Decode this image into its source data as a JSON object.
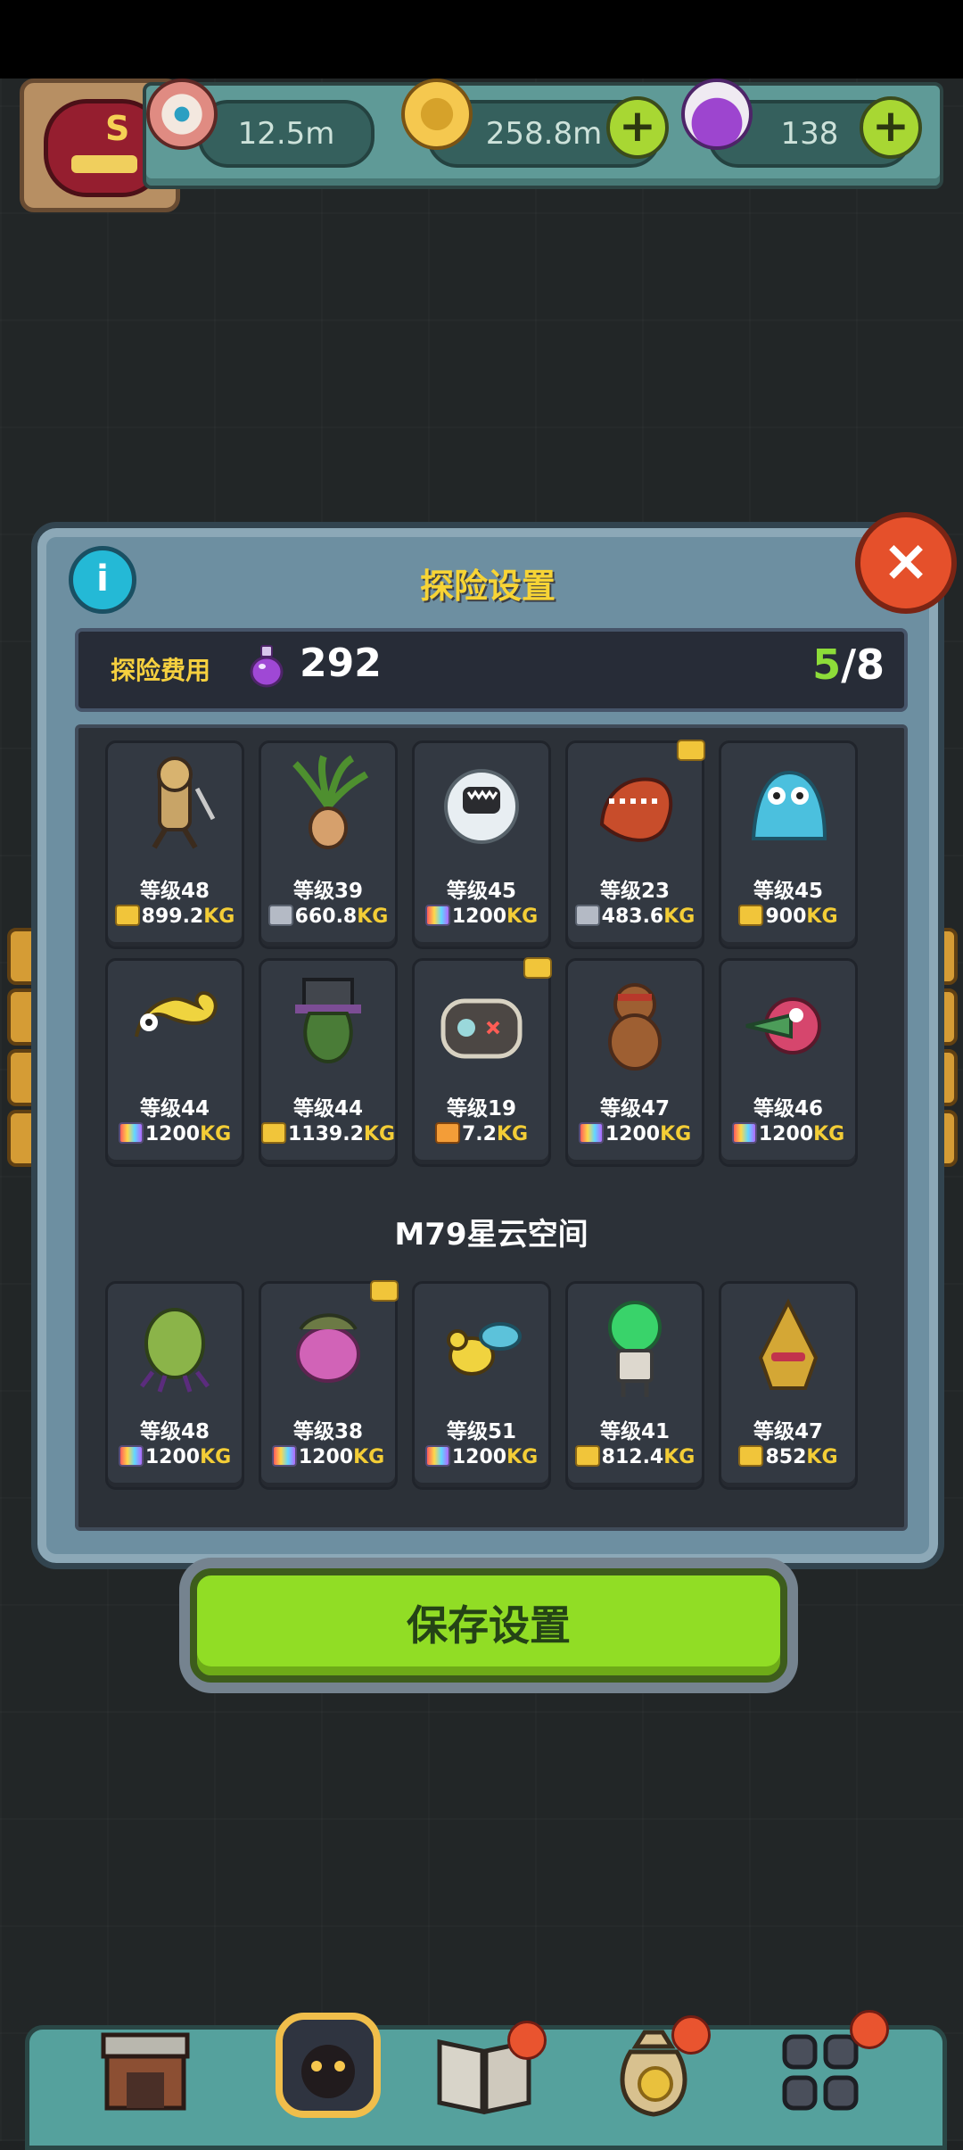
{
  "status_bar": {},
  "resources": {
    "eyes": "12.5m",
    "coins": "258.8m",
    "potions": "138"
  },
  "dialog": {
    "title": "探险设置",
    "cost_label": "探险费用",
    "cost_value": "292",
    "count_current": "5",
    "count_total": "/8",
    "section_label": "M79星云空间",
    "save_label": "保存设置"
  },
  "monsters_top": [
    {
      "level": "等级48",
      "weight": "899.2",
      "unit": "KG",
      "icon": "voodoo-doll",
      "weight_icon": "gold"
    },
    {
      "level": "等级39",
      "weight": "660.8",
      "unit": "KG",
      "icon": "mandrake",
      "weight_icon": "gray"
    },
    {
      "level": "等级45",
      "weight": "1200",
      "unit": "KG",
      "icon": "yeti",
      "weight_icon": "rainbow"
    },
    {
      "level": "等级23",
      "weight": "483.6",
      "unit": "KG",
      "icon": "red-dinosaur",
      "weight_icon": "gray",
      "badge": true
    },
    {
      "level": "等级45",
      "weight": "900",
      "unit": "KG",
      "icon": "blue-slime",
      "weight_icon": "gold"
    },
    {
      "level": "等级44",
      "weight": "1200",
      "unit": "KG",
      "icon": "yellow-lizard",
      "weight_icon": "rainbow"
    },
    {
      "level": "等级44",
      "weight": "1139.2",
      "unit": "KG",
      "icon": "top-hat-plant",
      "weight_icon": "gold"
    },
    {
      "level": "等级19",
      "weight": "7.2",
      "unit": "KG",
      "icon": "button-beast",
      "weight_icon": "orange",
      "badge": true
    },
    {
      "level": "等级47",
      "weight": "1200",
      "unit": "KG",
      "icon": "brown-bear",
      "weight_icon": "rainbow"
    },
    {
      "level": "等级46",
      "weight": "1200",
      "unit": "KG",
      "icon": "croc-bird",
      "weight_icon": "rainbow"
    }
  ],
  "monsters_bottom": [
    {
      "level": "等级48",
      "weight": "1200",
      "unit": "KG",
      "icon": "green-seed-creature",
      "weight_icon": "rainbow"
    },
    {
      "level": "等级38",
      "weight": "1200",
      "unit": "KG",
      "icon": "pink-bush",
      "weight_icon": "rainbow",
      "badge": true
    },
    {
      "level": "等级51",
      "weight": "1200",
      "unit": "KG",
      "icon": "bee",
      "weight_icon": "rainbow"
    },
    {
      "level": "等级41",
      "weight": "812.4",
      "unit": "KG",
      "icon": "green-robot",
      "weight_icon": "gold"
    },
    {
      "level": "等级47",
      "weight": "852",
      "unit": "KG",
      "icon": "pine-cone-monster",
      "weight_icon": "gold"
    }
  ],
  "colors": {
    "accent_green": "#8ddc39",
    "title_yellow": "#f7d435",
    "weight_gold": "#f3cd36",
    "dialog_blue": "#6d8fa1",
    "close_red": "#e5502b"
  },
  "icons": {
    "eye": "eye-icon",
    "coin": "coin-icon",
    "potion": "potion-icon",
    "info": "info-icon",
    "close": "close-icon"
  }
}
